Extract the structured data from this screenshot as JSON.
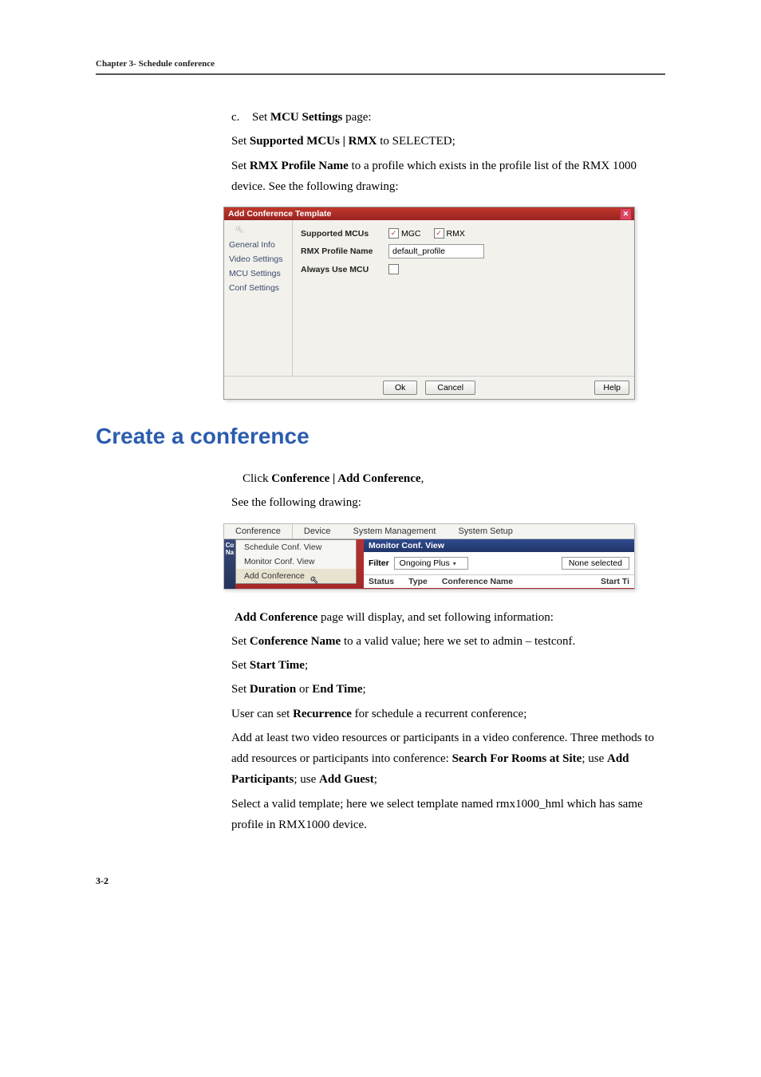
{
  "header": {
    "chapter": "Chapter 3- Schedule conference"
  },
  "body": {
    "c_letter": "c.",
    "c_text_prefix": "Set ",
    "c_text_bold": "MCU Settings",
    "c_text_suffix": " page:",
    "l1_prefix": "Set ",
    "l1_bold": "Supported MCUs | RMX",
    "l1_suffix": " to SELECTED;",
    "l2_prefix": "Set ",
    "l2_bold": "RMX Profile Name",
    "l2_suffix": " to a profile which exists in the profile list of the RMX 1000 device. See the following drawing:"
  },
  "dlg": {
    "title": "Add Conference Template",
    "nav": {
      "general": "General Info",
      "video": "Video Settings",
      "mcu": "MCU Settings",
      "conf": "Conf Settings"
    },
    "labels": {
      "supported": "Supported MCUs",
      "profile": "RMX Profile Name",
      "always": "Always Use MCU"
    },
    "checks": {
      "mgc": "MGC",
      "rmx": "RMX"
    },
    "profile_value": "default_profile",
    "buttons": {
      "ok": "Ok",
      "cancel": "Cancel",
      "help": "Help"
    }
  },
  "heading": "Create a conference",
  "body2": {
    "p1_prefix": "Click ",
    "p1_bold": "Conference | Add Conference",
    "p1_suffix": ",",
    "p2": "See the following drawing:"
  },
  "shot2": {
    "menus": {
      "conference": "Conference",
      "device": "Device",
      "sysmgmt": "System Management",
      "syssetup": "System Setup"
    },
    "left": {
      "co": "Co",
      "na": "Na"
    },
    "dropdown": {
      "schedule": "Schedule Conf. View",
      "monitor": "Monitor Conf. View",
      "add": "Add Conference"
    },
    "monitor_bar": "Monitor Conf. View",
    "filter_label": "Filter",
    "filter_value": "Ongoing Plus",
    "none_selected": "None selected",
    "cols": {
      "status": "Status",
      "type": "Type",
      "confname": "Conference Name",
      "start": "Start Ti"
    }
  },
  "body3": {
    "p1_bold": "Add Conference",
    "p1_rest": " page will display, and set following information:",
    "p2_prefix": "Set ",
    "p2_bold": "Conference Name",
    "p2_suffix": " to a valid value; here we set to admin – testconf.",
    "p3_prefix": "Set ",
    "p3_bold": "Start Time",
    "p3_suffix": ";",
    "p4_prefix": "Set ",
    "p4_bold1": "Duration",
    "p4_mid": " or ",
    "p4_bold2": "End Time",
    "p4_suffix": ";",
    "p5_prefix": "User can set ",
    "p5_bold": "Recurrence",
    "p5_suffix": " for schedule a recurrent conference;",
    "p6_l1": "Add at least two video resources or participants in a video conference. Three methods to add resources or participants into conference: ",
    "p6_b1": "Search For Rooms at Site",
    "p6_m1": "; use ",
    "p6_b2": "Add Participants",
    "p6_m2": "; use ",
    "p6_b3": "Add Guest",
    "p6_suffix": ";",
    "p7": "Select a valid template; here we select template named rmx1000_hml which has same profile in RMX1000 device."
  },
  "page_number": "3-2"
}
